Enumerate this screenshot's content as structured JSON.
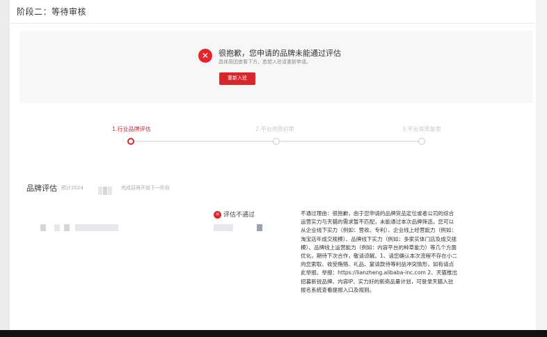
{
  "page": {
    "header": "阶段二：等待审核"
  },
  "result": {
    "title": "很抱歉，您申请的品牌未能通过评估",
    "subtitle": "具体原因查看下方，若想入驻请重新申请。",
    "reapply_label": "重新入驻",
    "status_color": "#e5242b"
  },
  "steps": [
    {
      "label": "1.行业品牌评估",
      "active": true
    },
    {
      "label": "2.平台资质初审",
      "active": false
    },
    {
      "label": "3.平台资质复审",
      "active": false
    }
  ],
  "evaluation": {
    "title": "品牌评估",
    "note_prefix": "预计2024",
    "note_suffix": "完成后将开始下一阶段",
    "status_label": "评估不通过",
    "reason": "不通过理由：很抱歉，由于您申请的品牌货品定位或者公司的综合运营实力与天猫的需求暂不匹配，未能通过本次品牌筛选，您可以从企业线下实力（例如：营收、专利）、企业线上经营能力（例如：淘宝店年成交规模）、品牌线下实力（例如：多家实体门店及成交规模）、品牌线上运营能力（例如：内容平台的种草能力）等几个方面优化，期待下次合作，敬请谅解。1、请您确认本次流程不存在小二向您索取、收受贿赂、礼品、宴请款待等利益冲突情形，如有请点此举报。举报：https://lianzheng.alibaba-inc.com 2、天猫推出招募新锐品牌、内容IP、实力好的新商品量计划，可登录天猫入驻报名系统查看提报入口及规则。"
  },
  "colors": {
    "accent": "#d8262b",
    "inactive": "#c8c8c8"
  }
}
